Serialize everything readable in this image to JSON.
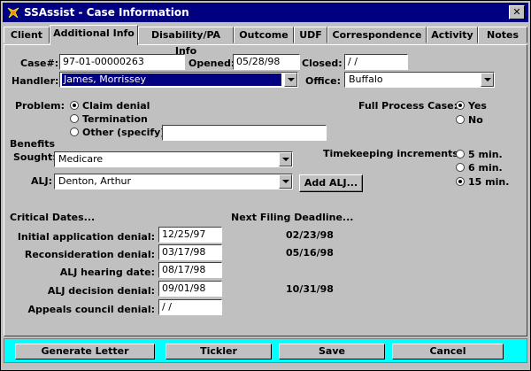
{
  "window": {
    "title": "SSAssist - Case Information",
    "close_label": "✕"
  },
  "tabs": [
    {
      "label": "Client"
    },
    {
      "label": "Additional Info"
    },
    {
      "label": "Disability/PA Info"
    },
    {
      "label": "Outcome"
    },
    {
      "label": "UDF"
    },
    {
      "label": "Correspondence"
    },
    {
      "label": "Activity"
    },
    {
      "label": "Notes"
    }
  ],
  "case": {
    "case_label": "Case#:",
    "case_value": "97-01-00000263",
    "opened_label": "Opened:",
    "opened_value": "05/28/98",
    "closed_label": "Closed:",
    "closed_value": " / /",
    "handler_label": "Handler:",
    "handler_value": "James, Morrissey",
    "office_label": "Office:",
    "office_value": "Buffalo"
  },
  "problem": {
    "label": "Problem:",
    "options": [
      {
        "label": "Claim denial",
        "selected": true
      },
      {
        "label": "Termination",
        "selected": false
      },
      {
        "label": "Other (specify):",
        "selected": false
      }
    ],
    "other_value": ""
  },
  "full_process": {
    "label": "Full Process Case:",
    "options": [
      {
        "label": "Yes",
        "selected": true
      },
      {
        "label": "No",
        "selected": false
      }
    ]
  },
  "benefits": {
    "label1": "Benefits",
    "label2": "Sought:",
    "value": "Medicare"
  },
  "timekeeping": {
    "label": "Timekeeping increments:",
    "options": [
      {
        "label": "5 min.",
        "selected": false
      },
      {
        "label": "6 min.",
        "selected": false
      },
      {
        "label": "15 min.",
        "selected": true
      }
    ]
  },
  "alj": {
    "label": "ALJ:",
    "value": "Denton, Arthur",
    "add_label": "Add ALJ..."
  },
  "critical": {
    "header": "Critical Dates...",
    "next_header": "Next Filing Deadline...",
    "rows": [
      {
        "label": "Initial application denial:",
        "value": "12/25/97",
        "deadline": "02/23/98"
      },
      {
        "label": "Reconsideration denial:",
        "value": "03/17/98",
        "deadline": "05/16/98"
      },
      {
        "label": "ALJ hearing date:",
        "value": "08/17/98",
        "deadline": ""
      },
      {
        "label": "ALJ decision denial:",
        "value": "09/01/98",
        "deadline": "10/31/98"
      },
      {
        "label": "Appeals council denial:",
        "value": " / /",
        "deadline": ""
      }
    ]
  },
  "footer": {
    "generate": "Generate Letter",
    "tickler": "Tickler",
    "save": "Save",
    "cancel": "Cancel"
  }
}
